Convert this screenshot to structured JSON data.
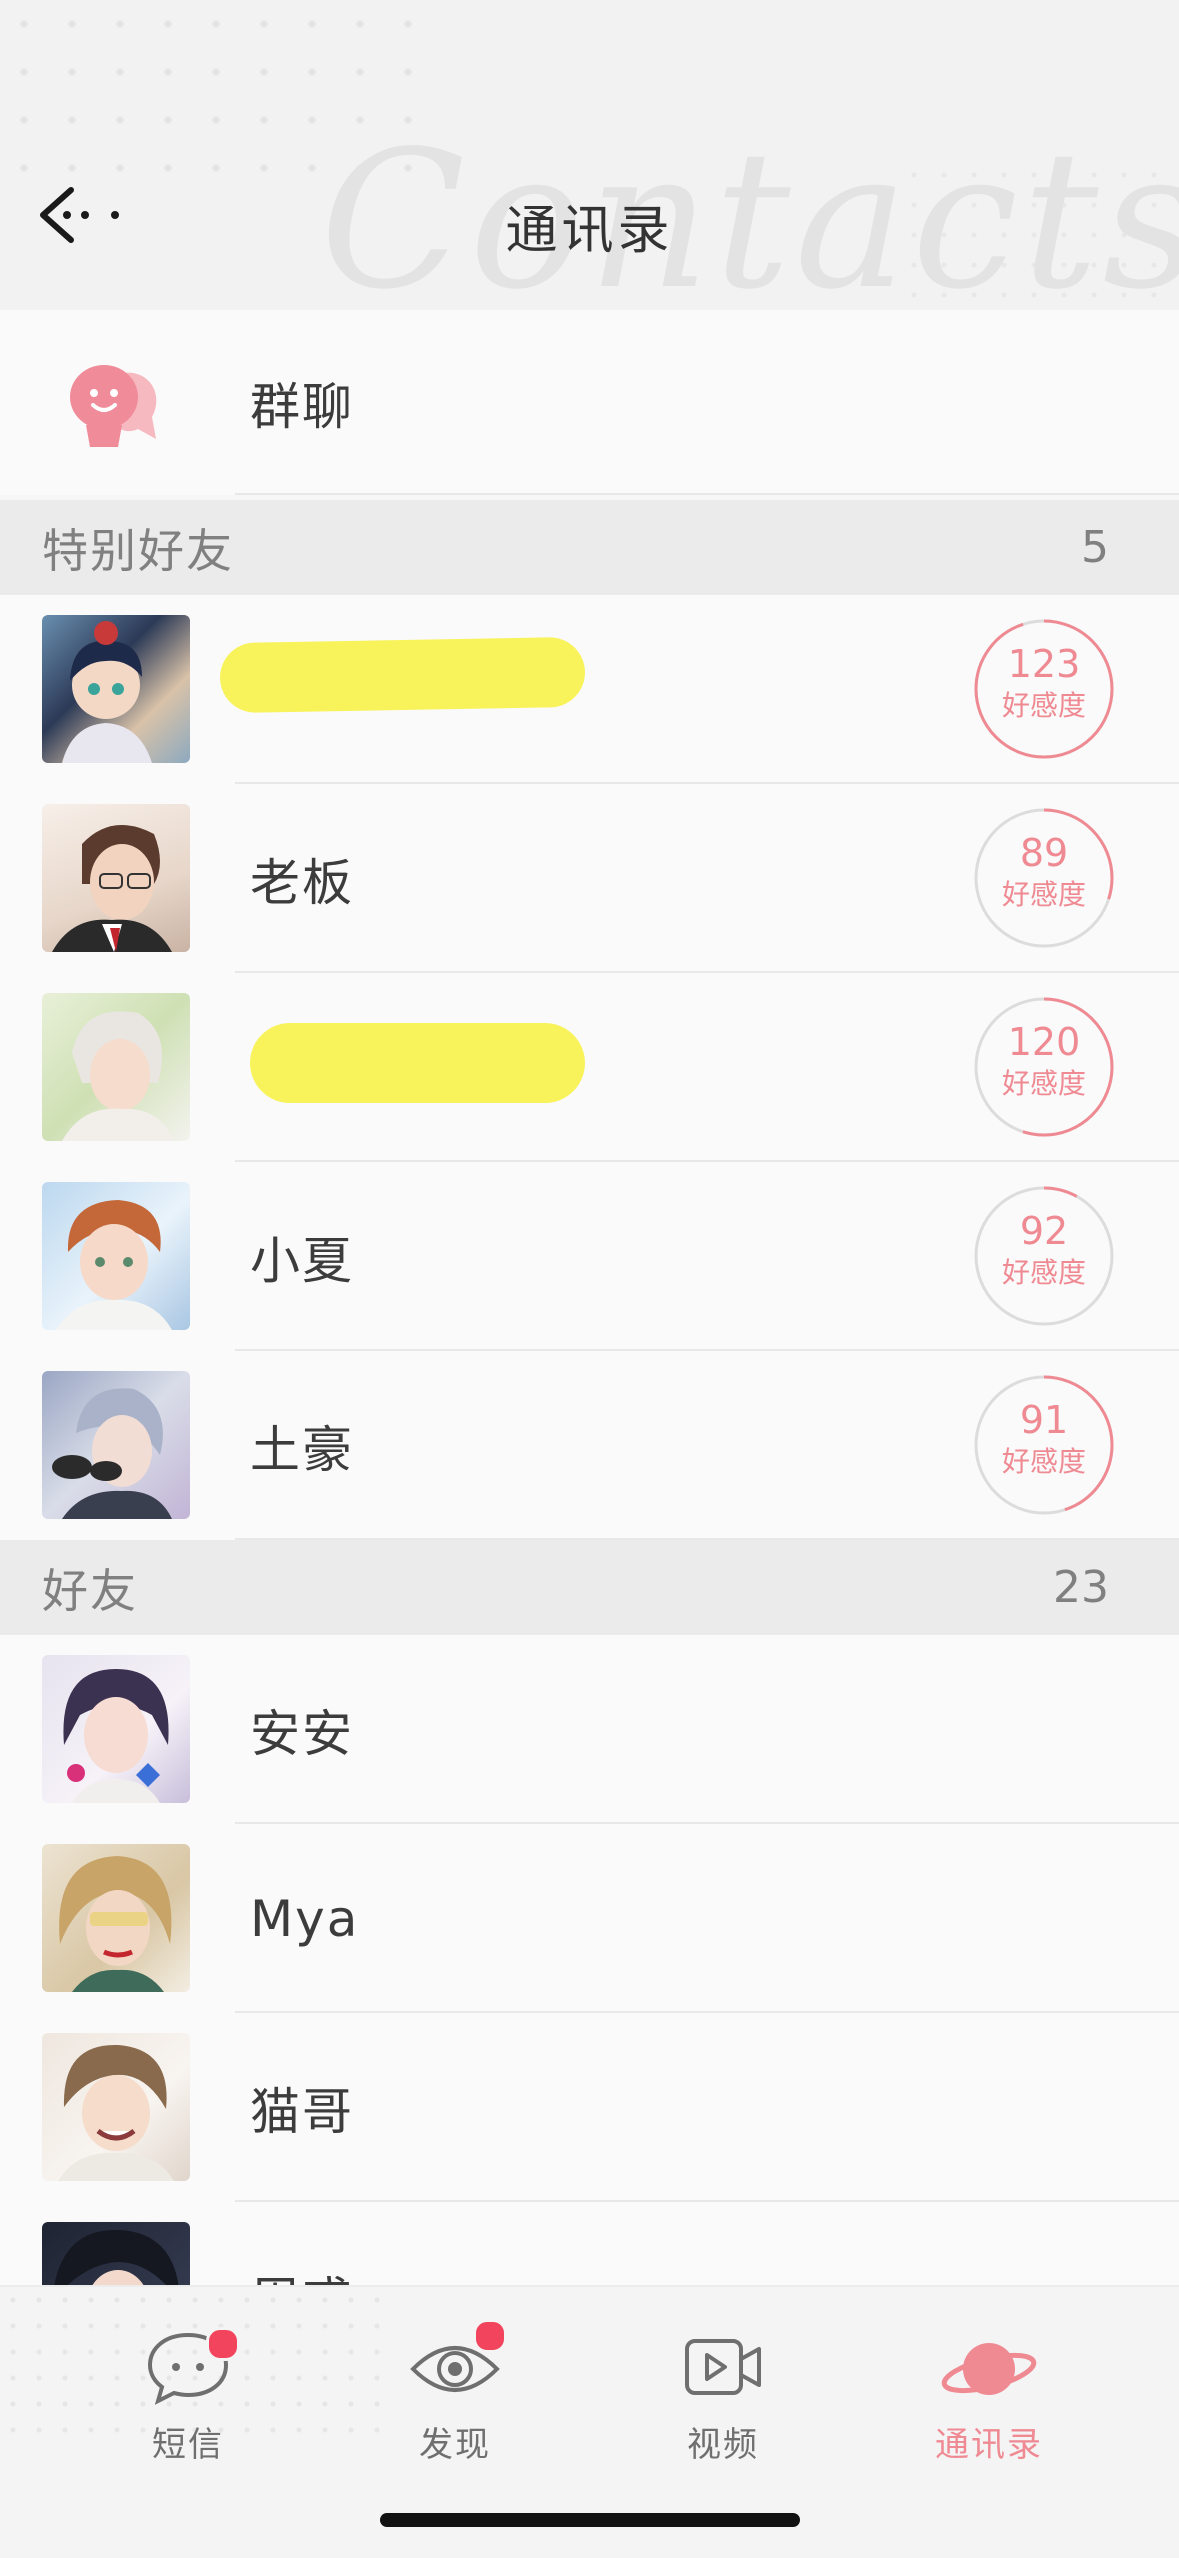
{
  "header": {
    "title": "通讯录",
    "watermark": "Contacts"
  },
  "group_chat": {
    "label": "群聊"
  },
  "special_friends": {
    "label": "特别好友",
    "count": "5",
    "items": [
      {
        "name": "",
        "favor": "123",
        "favor_label": "好感度",
        "favor_level": 0.95
      },
      {
        "name": "老板",
        "favor": "89",
        "favor_label": "好感度",
        "favor_level": 0.3
      },
      {
        "name": "",
        "favor": "120",
        "favor_label": "好感度",
        "favor_level": 0.55
      },
      {
        "name": "小夏",
        "favor": "92",
        "favor_label": "好感度",
        "favor_level": 0.08
      },
      {
        "name": "土豪",
        "favor": "91",
        "favor_label": "好感度",
        "favor_level": 0.45
      }
    ]
  },
  "friends": {
    "label": "好友",
    "count": "23",
    "items": [
      {
        "name": "安安"
      },
      {
        "name": "Mya"
      },
      {
        "name": "猫哥"
      },
      {
        "name": "周惑"
      }
    ]
  },
  "tabbar": {
    "items": [
      {
        "label": "短信",
        "icon": "chat-bubble-icon",
        "badge": true
      },
      {
        "label": "发现",
        "icon": "eye-icon",
        "badge": true
      },
      {
        "label": "视频",
        "icon": "video-camera-icon",
        "badge": false
      },
      {
        "label": "通讯录",
        "icon": "planet-icon",
        "badge": false,
        "active": true
      }
    ]
  },
  "colors": {
    "accent": "#ef8a93",
    "badge": "#f2445c",
    "highlight": "#f8f35a",
    "section_bg": "#ebebeb"
  }
}
